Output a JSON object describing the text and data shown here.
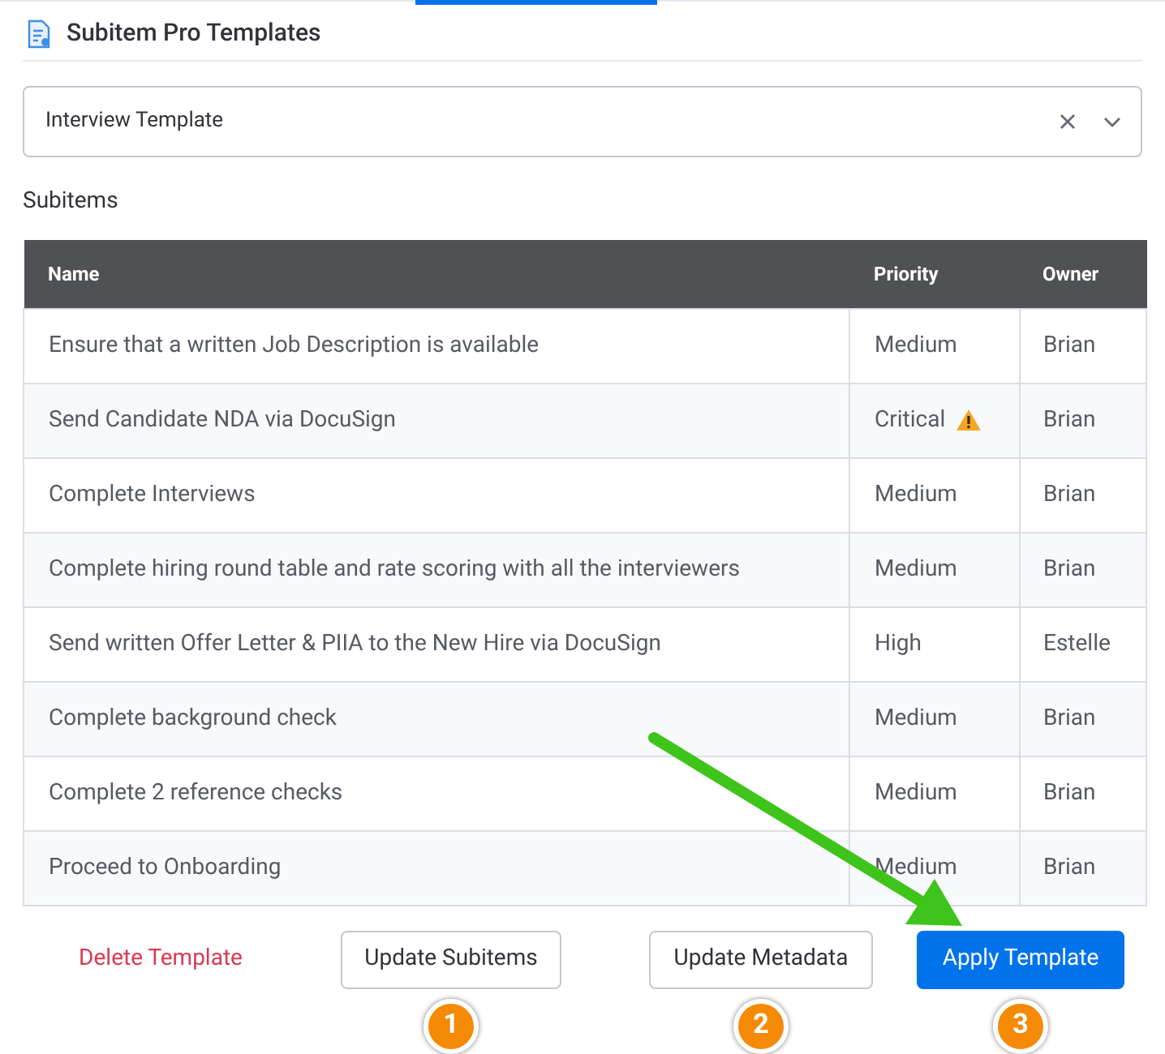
{
  "header": {
    "title": "Subitem Pro Templates"
  },
  "template_select": {
    "value": "Interview Template"
  },
  "section_label": "Subitems",
  "table": {
    "columns": [
      "Name",
      "Priority",
      "Owner"
    ],
    "rows": [
      {
        "name": "Ensure that a written Job Description is available",
        "priority": "Medium",
        "owner": "Brian",
        "warning": false
      },
      {
        "name": "Send Candidate NDA via DocuSign",
        "priority": "Critical",
        "owner": "Brian",
        "warning": true
      },
      {
        "name": "Complete Interviews",
        "priority": "Medium",
        "owner": "Brian",
        "warning": false
      },
      {
        "name": "Complete hiring round table and rate scoring with all the interviewers",
        "priority": "Medium",
        "owner": "Brian",
        "warning": false
      },
      {
        "name": "Send written Offer Letter & PIIA to the New Hire via DocuSign",
        "priority": "High",
        "owner": "Estelle",
        "warning": false
      },
      {
        "name": "Complete background check",
        "priority": "Medium",
        "owner": "Brian",
        "warning": false
      },
      {
        "name": "Complete 2 reference checks",
        "priority": "Medium",
        "owner": "Brian",
        "warning": false
      },
      {
        "name": "Proceed to Onboarding",
        "priority": "Medium",
        "owner": "Brian",
        "warning": false
      }
    ]
  },
  "actions": [
    {
      "label": "Delete Template",
      "kind": "link"
    },
    {
      "label": "Update Subitems",
      "kind": "outline",
      "step": "1"
    },
    {
      "label": "Update Metadata",
      "kind": "outline",
      "step": "2"
    },
    {
      "label": "Apply Template",
      "kind": "primary",
      "step": "3"
    }
  ]
}
